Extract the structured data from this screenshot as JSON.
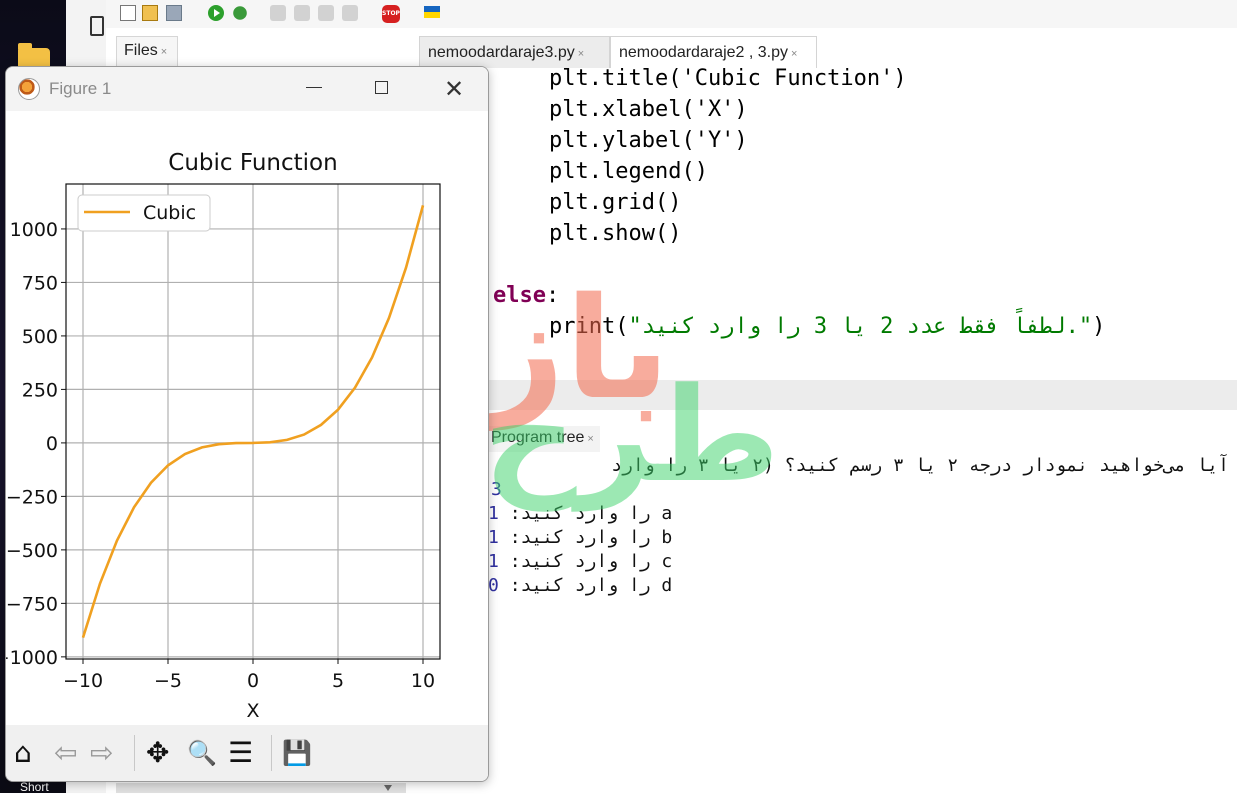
{
  "desktop": {
    "shortcut_label": "Short"
  },
  "ide": {
    "files_tab": "Files",
    "tabs": [
      {
        "label": "nemoodardaraje3.py",
        "active": false
      },
      {
        "label": "nemoodardaraje2 , 3.py",
        "active": true
      }
    ],
    "close_glyph": "×",
    "toolbar_icons": [
      "new-file-icon",
      "open-folder-icon",
      "save-icon",
      "run-icon",
      "debug-icon",
      "step-over-icon",
      "step-into-icon",
      "step-out-icon",
      "resume-icon",
      "stop-icon",
      "ukraine-flag-icon"
    ],
    "code": {
      "line1": "plt.title('Cubic Function')",
      "line2": "plt.xlabel('X')",
      "line3": "plt.ylabel('Y')",
      "line4": "plt.legend()",
      "line5": "plt.grid()",
      "line6": "plt.show()",
      "else_kw": "else",
      "else_colon": ":",
      "print_fn": "print",
      "print_open": "(",
      "print_str": "\"لطفاً فقط عدد 2 یا 3 را وارد کنید.\"",
      "print_close": ")"
    },
    "bottom_tab": "Program tree",
    "shell": {
      "prompt_line": "آیا می‌خواهید نمودار درجه ۲ یا ۳ رسم کنید؟ (۲ یا ۳ را وارد",
      "answer": "3",
      "rows": [
        {
          "text": "a را وارد کنید:",
          "value": "1"
        },
        {
          "text": "b را وارد کنید:",
          "value": "1"
        },
        {
          "text": "c را وارد کنید:",
          "value": "1"
        },
        {
          "text": "d را وارد کنید:",
          "value": "0"
        }
      ]
    }
  },
  "watermark": {
    "red": "بازار",
    "green": "طرح"
  },
  "figure": {
    "window_title": "Figure 1",
    "window_controls": {
      "close": "✕"
    },
    "toolbar": {
      "home": "⌂",
      "back": "⇦",
      "forward": "⇨",
      "pan": "✥",
      "zoom": "🔍",
      "config": "☰",
      "save": "💾"
    }
  },
  "chart_data": {
    "type": "line",
    "title": "Cubic Function",
    "xlabel": "X",
    "ylabel": "",
    "legend": [
      "Cubic"
    ],
    "legend_position": "top-left",
    "grid": true,
    "xlim": [
      -11,
      11
    ],
    "ylim": [
      -1010,
      1210
    ],
    "xticks": [
      -10,
      -5,
      0,
      5,
      10
    ],
    "xtick_labels": [
      "−10",
      "−5",
      "0",
      "5",
      "10"
    ],
    "yticks": [
      -1000,
      -750,
      -500,
      -250,
      0,
      250,
      500,
      750,
      1000
    ],
    "ytick_labels": [
      "−1000",
      "−750",
      "−500",
      "−250",
      "0",
      "250",
      "500",
      "750",
      "1000"
    ],
    "series": [
      {
        "name": "Cubic",
        "color": "#f0a020",
        "x": [
          -10,
          -9,
          -8,
          -7,
          -6,
          -5,
          -4,
          -3,
          -2,
          -1,
          0,
          1,
          2,
          3,
          4,
          5,
          6,
          7,
          8,
          9,
          10
        ],
        "y": [
          -910,
          -657,
          -456,
          -301,
          -186,
          -105,
          -52,
          -21,
          -6,
          -1,
          0,
          3,
          14,
          39,
          84,
          155,
          258,
          399,
          584,
          819,
          1110
        ]
      }
    ]
  }
}
